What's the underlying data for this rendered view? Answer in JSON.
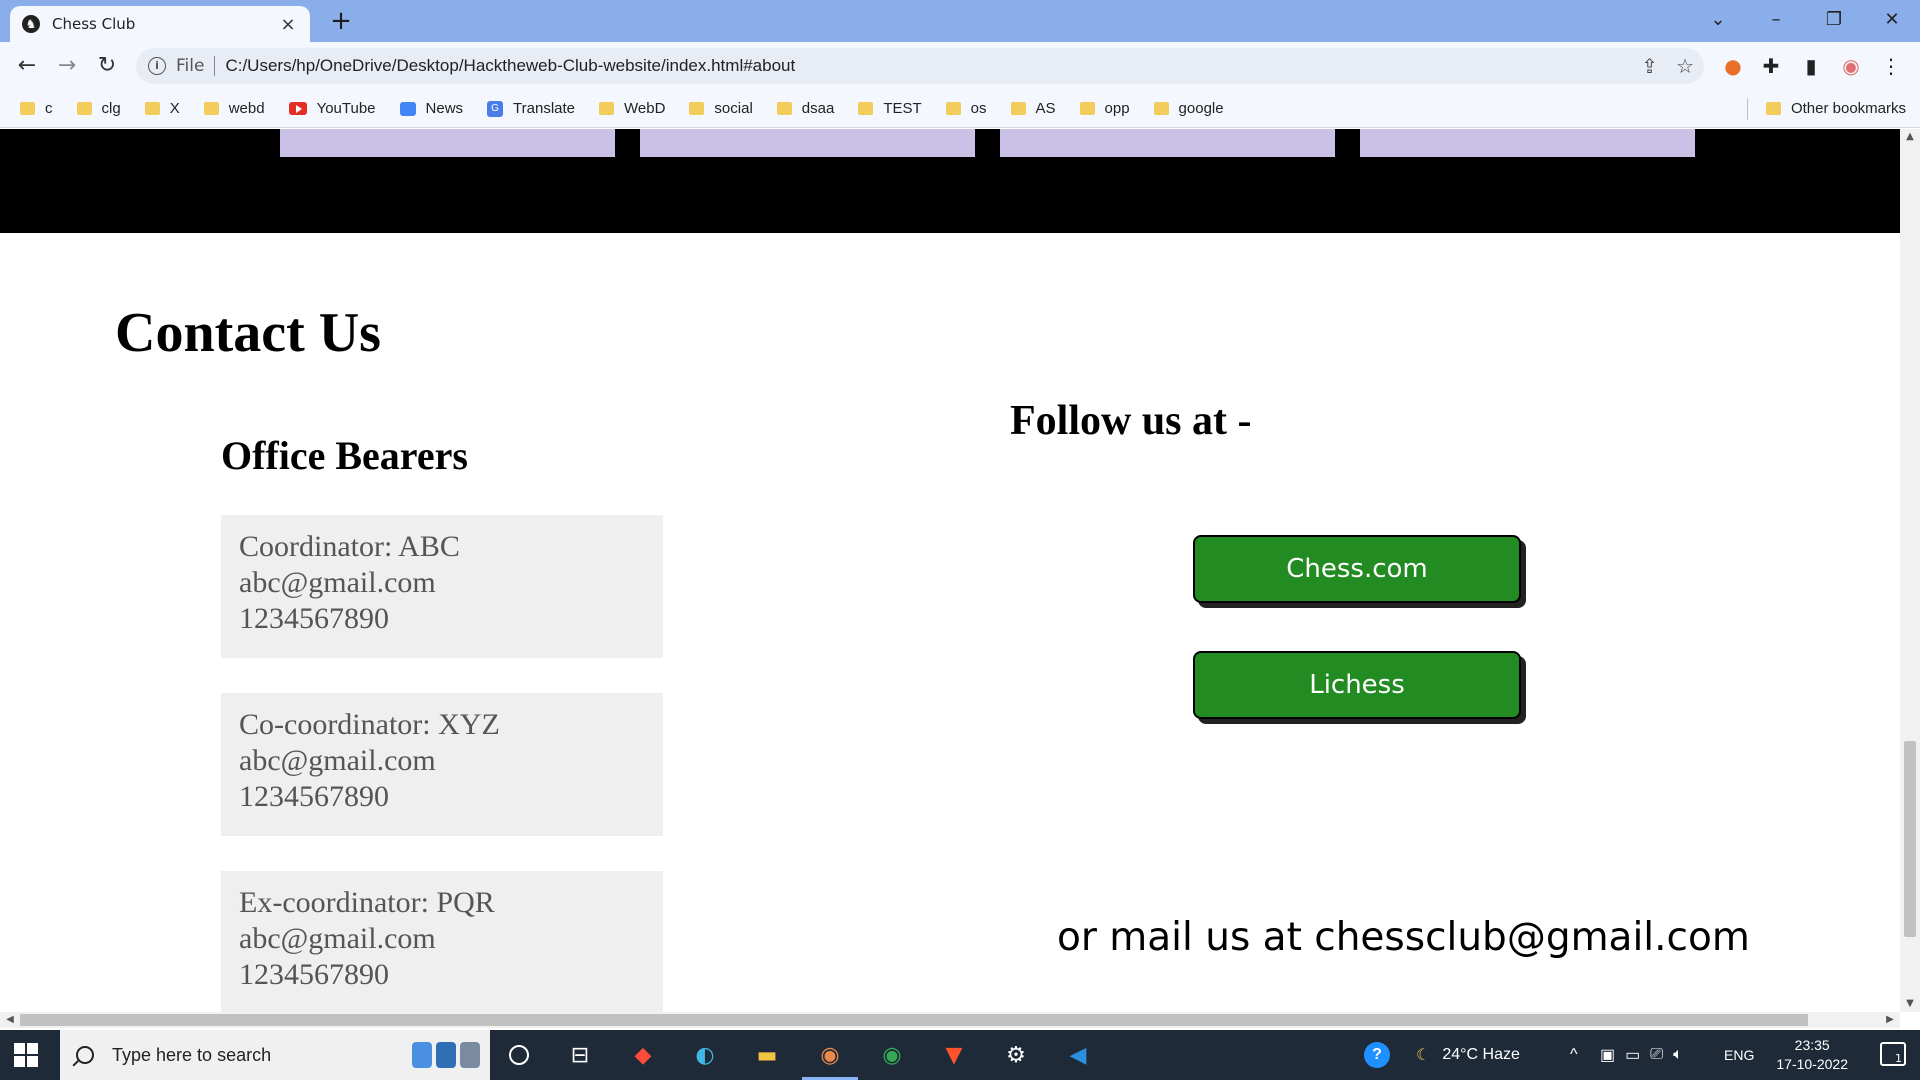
{
  "browser": {
    "tab_title": "Chess Club",
    "new_tab": "+",
    "file_label": "File",
    "url": "C:/Users/hp/OneDrive/Desktop/Hacktheweb-Club-website/index.html#about",
    "bookmarks": [
      {
        "label": "c",
        "icon": "folder-icon"
      },
      {
        "label": "clg",
        "icon": "folder-icon"
      },
      {
        "label": "X",
        "icon": "folder-icon"
      },
      {
        "label": "webd",
        "icon": "folder-icon"
      },
      {
        "label": "YouTube",
        "icon": "youtube-icon"
      },
      {
        "label": "News",
        "icon": "google-news-icon"
      },
      {
        "label": "Translate",
        "icon": "google-translate-icon"
      },
      {
        "label": "WebD",
        "icon": "folder-icon"
      },
      {
        "label": "social",
        "icon": "folder-icon"
      },
      {
        "label": "dsaa",
        "icon": "folder-icon"
      },
      {
        "label": "TEST",
        "icon": "folder-icon"
      },
      {
        "label": "os",
        "icon": "folder-icon"
      },
      {
        "label": "AS",
        "icon": "folder-icon"
      },
      {
        "label": "opp",
        "icon": "folder-icon"
      },
      {
        "label": "google",
        "icon": "folder-icon"
      }
    ],
    "other_bookmarks": "Other bookmarks"
  },
  "page": {
    "contact_title": "Contact Us",
    "office_title": "Office Bearers",
    "bearers": [
      {
        "role": "Coordinator: ABC",
        "email": "abc@gmail.com",
        "phone": "1234567890"
      },
      {
        "role": "Co-coordinator: XYZ",
        "email": "abc@gmail.com",
        "phone": "1234567890"
      },
      {
        "role": "Ex-coordinator: PQR",
        "email": "abc@gmail.com",
        "phone": "1234567890"
      }
    ],
    "follow_title": "Follow us at -",
    "social_buttons": [
      "Chess.com",
      "Lichess"
    ],
    "mail_line": "or mail us at chessclub@gmail.com"
  },
  "taskbar": {
    "search_placeholder": "Type here to search",
    "weather": "24°C  Haze",
    "language": "ENG",
    "time": "23:35",
    "date": "17-10-2022",
    "notification_count": "1"
  },
  "colors": {
    "tab_strip": "#8aaee9",
    "card_bottom": "#cbc0e5",
    "social_button": "#228b22",
    "bearer_card": "#efefef",
    "taskbar": "#1f2a38"
  }
}
